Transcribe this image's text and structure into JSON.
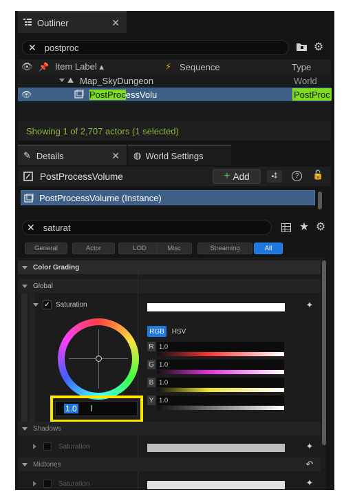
{
  "outliner": {
    "tab_label": "Outliner",
    "search_value": "postproc",
    "columns": {
      "item_label": "Item Label",
      "sequence": "Sequence",
      "type": "Type"
    },
    "tree": [
      {
        "label": "Map_SkyDungeon",
        "type": "World"
      },
      {
        "label_highlight": "PostProc",
        "label_rest": "essVolu",
        "type": "PostProc"
      }
    ],
    "status": "Showing 1 of 2,707 actors (1 selected)"
  },
  "details": {
    "tab_label": "Details",
    "world_settings_tab": "World Settings",
    "actor_name": "PostProcessVolume",
    "add_label": "Add",
    "component": "PostProcessVolume (Instance)",
    "search_value": "saturat",
    "filters": [
      "General",
      "Actor",
      "LOD",
      "Misc",
      "Streaming",
      "All"
    ],
    "sections": {
      "color_grading": "Color Grading",
      "global": "Global",
      "saturation": "Saturation",
      "shadows": "Shadows",
      "midtones": "Midtones"
    },
    "picker": {
      "rgb": "RGB",
      "hsv": "HSV",
      "channels": [
        {
          "label": "R",
          "value": "1.0"
        },
        {
          "label": "G",
          "value": "1.0"
        },
        {
          "label": "B",
          "value": "1.0"
        },
        {
          "label": "Y",
          "value": "1.0"
        }
      ],
      "edit_value": "1.0"
    }
  },
  "colors": {
    "accent_blue": "#1e78e0",
    "selection_row": "#3e5f86",
    "search_highlight": "#7ddc1f",
    "status_green": "#8ab83c",
    "callout_yellow": "#ffe600"
  }
}
